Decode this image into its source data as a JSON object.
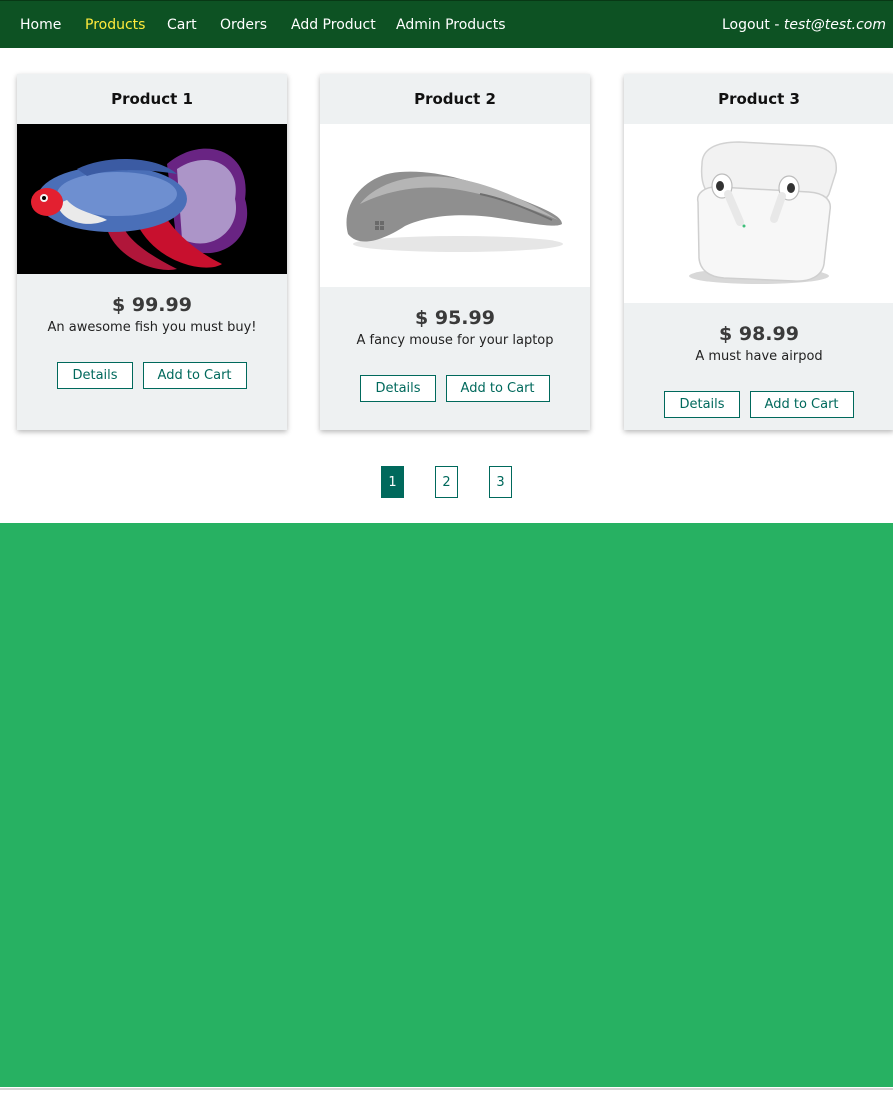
{
  "nav": {
    "items": [
      {
        "label": "Home",
        "active": false
      },
      {
        "label": "Products",
        "active": true
      },
      {
        "label": "Cart",
        "active": false
      },
      {
        "label": "Orders",
        "active": false
      },
      {
        "label": "Add Product",
        "active": false
      },
      {
        "label": "Admin Products",
        "active": false
      }
    ],
    "logout_label": "Logout - ",
    "user_email": "test@test.com"
  },
  "products": [
    {
      "title": "Product 1",
      "price": "$ 99.99",
      "description": "An awesome fish you must buy!",
      "image_icon": "betta-fish-image",
      "details_label": "Details",
      "cart_label": "Add to Cart"
    },
    {
      "title": "Product 2",
      "price": "$ 95.99",
      "description": "A fancy mouse for your laptop",
      "image_icon": "arc-mouse-image",
      "details_label": "Details",
      "cart_label": "Add to Cart"
    },
    {
      "title": "Product 3",
      "price": "$ 98.99",
      "description": "A must have airpod",
      "image_icon": "airpods-image",
      "details_label": "Details",
      "cart_label": "Add to Cart"
    }
  ],
  "pagination": {
    "pages": [
      "1",
      "2",
      "3"
    ],
    "current": "1"
  },
  "colors": {
    "navbar": "#0d5223",
    "active_nav": "#ffeb3b",
    "accent": "#00695c",
    "footer": "#27b162",
    "card_bg": "#eef1f2"
  }
}
